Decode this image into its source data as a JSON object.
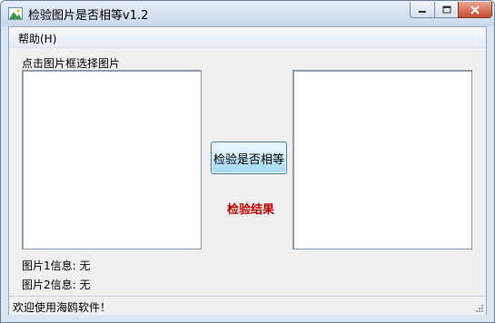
{
  "window": {
    "title": "检验图片是否相等v1.2",
    "icon": "landscape-picture-icon"
  },
  "title_buttons": {
    "minimize_icon": "minimize-icon",
    "maximize_icon": "maximize-icon",
    "close_icon": "close-icon"
  },
  "menu": {
    "items": [
      {
        "label": "帮助(H)"
      }
    ]
  },
  "instruction": "点击图片框选择图片",
  "check_button": {
    "label": "检验是否相等"
  },
  "result_label": "检验结果",
  "image1_info": "图片1信息: 无",
  "image2_info": "图片2信息: 无",
  "status": {
    "text": "欢迎使用海鸥软件！"
  },
  "colors": {
    "result_text": "#c00000",
    "window_frame": "#dbe6f3",
    "button_border": "#3c7fb1"
  }
}
